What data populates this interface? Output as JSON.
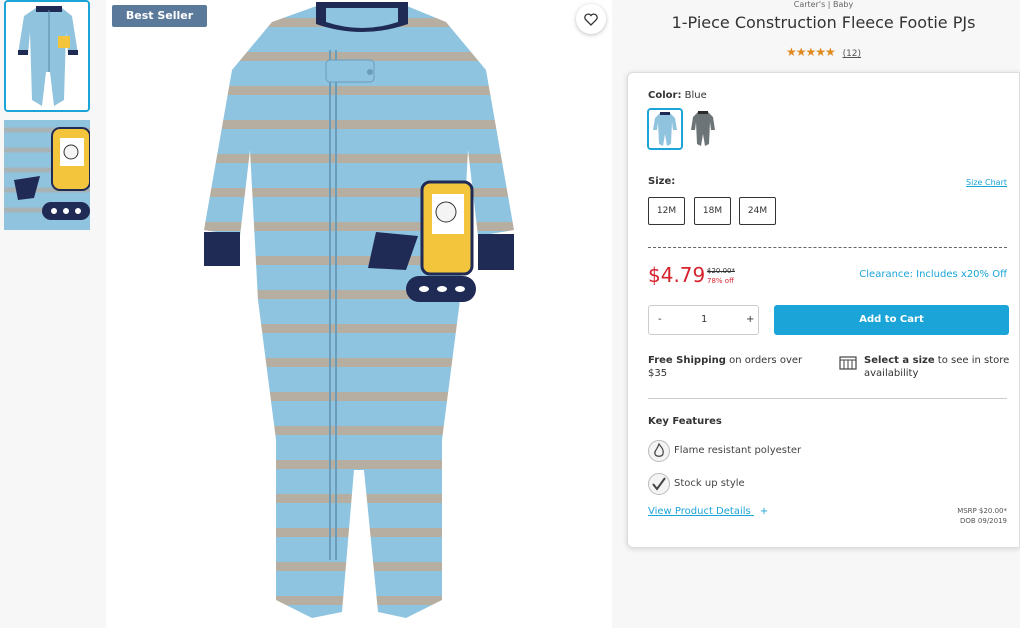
{
  "thumbnails": [
    {
      "alt": ""
    },
    {
      "alt": ""
    }
  ],
  "badge": "Best Seller",
  "product": {
    "brand": "Carter's | Baby",
    "title": "1-Piece Construction Fleece Footie PJs",
    "stars": "★★★★★",
    "rating_value": 4.5,
    "review_count": "(12)"
  },
  "color": {
    "label": "Color:",
    "value": "Blue"
  },
  "size": {
    "label": "Size:",
    "chart_link": "Size Chart",
    "options": [
      "12M",
      "18M",
      "24M"
    ]
  },
  "pricing": {
    "price": "$4.79",
    "was": "$20.00*",
    "off": "78% off",
    "clearance": "Clearance: Includes x20% Off"
  },
  "quantity": {
    "minus": "-",
    "value": "1",
    "plus": "+"
  },
  "add_to_cart": "Add to Cart",
  "shipping": {
    "bold": "Free Shipping",
    "rest": " on orders over $35"
  },
  "store": {
    "bold": "Select a size",
    "rest": " to see in store availability"
  },
  "key_features": {
    "title": "Key Features",
    "items": [
      "Flame resistant polyester",
      "Stock up style"
    ]
  },
  "view_details": "View Product Details",
  "view_details_plus": "+",
  "msrp": {
    "line1": "MSRP $20.00*",
    "line2": "DOB 09/2019"
  },
  "colors": {
    "accent": "#1ba4d8",
    "price": "#d6232e",
    "badge": "#5b7a9b",
    "star": "#e08a1e"
  }
}
